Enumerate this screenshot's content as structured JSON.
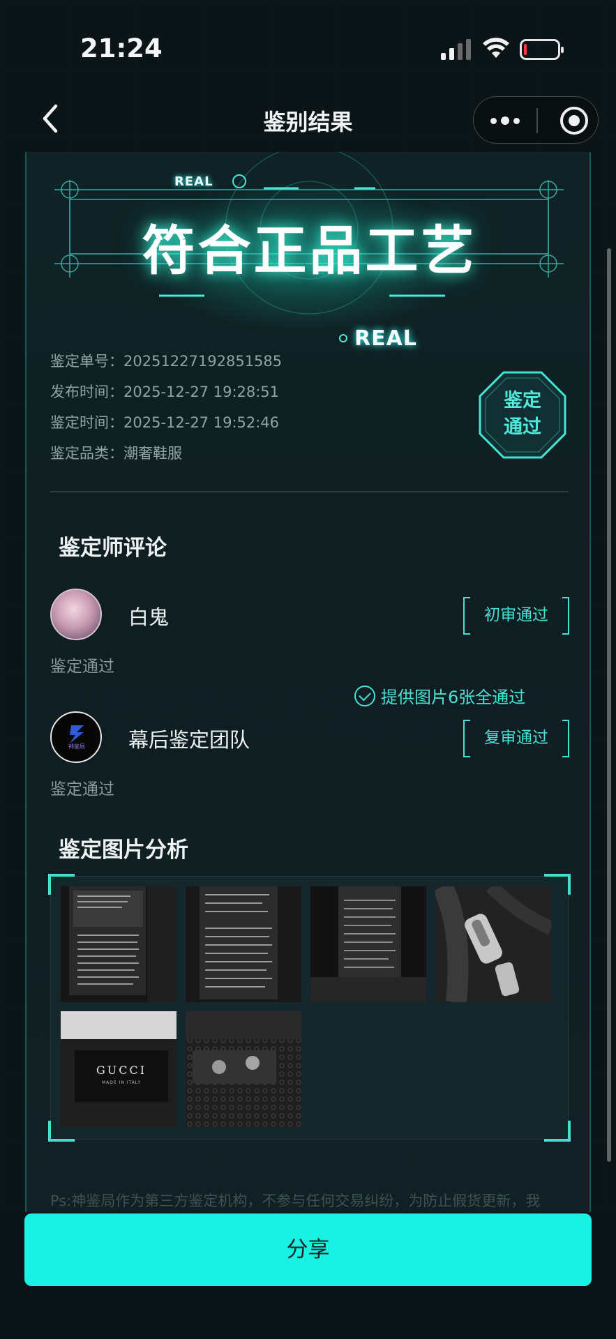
{
  "status_bar": {
    "time": "21:24",
    "icons": [
      "cellular-signal-icon",
      "wifi-icon",
      "battery-low-icon"
    ],
    "battery_color": "#ff3b30"
  },
  "nav": {
    "title": "鉴别结果",
    "icons": [
      "back-chevron-icon",
      "more-dots-icon",
      "target-close-icon"
    ]
  },
  "hero": {
    "real_top": "REAL",
    "title": "符合正品工艺",
    "real_bottom": "REAL",
    "accent_color": "#3fe6d6"
  },
  "info": [
    {
      "label": "鉴定单号：",
      "value": "20251227192851585"
    },
    {
      "label": "发布时间：",
      "value": "2025-12-27 19:28:51"
    },
    {
      "label": "鉴定时间：",
      "value": "2025-12-27 19:52:46"
    },
    {
      "label": "鉴定品类：",
      "value": "潮奢鞋服"
    }
  ],
  "badge": {
    "line1": "鉴定",
    "line2": "通过"
  },
  "reviews": {
    "title": "鉴定师评论",
    "items": [
      {
        "name": "白鬼",
        "tag": "初审通过",
        "note": "鉴定通过"
      },
      {
        "name": "幕后鉴定团队",
        "tag": "复审通过",
        "note": "鉴定通过",
        "logo_text": "神鉴局"
      }
    ]
  },
  "images": {
    "title": "鉴定图片分析",
    "pass_text": "提供图片6张全通过",
    "count": 6,
    "thumbs": [
      "care-label-1",
      "care-label-2",
      "care-label-3",
      "zipper-pull",
      "gucci-neck-label",
      "gucci-snap-lining"
    ],
    "brand_text": "GUCCI",
    "brand_subtext": "MADE IN ITALY"
  },
  "disclaimer": "Ps:神鉴局作为第三方鉴定机构，不参与任何交易纠纷，为防止假货更新，我",
  "share_button": "分享",
  "colors": {
    "background": "#0b1417",
    "card": "#0f2326",
    "accent": "#44e3d5",
    "share_button": "#19f2e3"
  }
}
